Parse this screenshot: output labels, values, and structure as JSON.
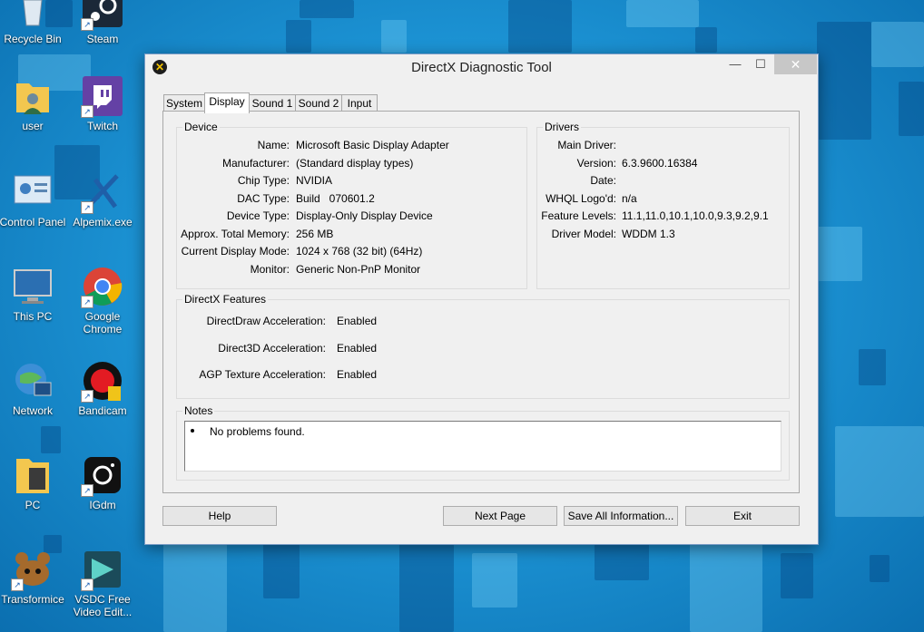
{
  "desktop": {
    "icons": [
      {
        "label": "Recycle Bin",
        "icon": "recycle-bin-icon"
      },
      {
        "label": "Steam",
        "icon": "steam-icon"
      },
      {
        "label": "user",
        "icon": "user-folder-icon"
      },
      {
        "label": "Twitch",
        "icon": "twitch-icon"
      },
      {
        "label": "Control Panel",
        "icon": "control-panel-icon"
      },
      {
        "label": "Alpemix.exe",
        "icon": "alpemix-icon"
      },
      {
        "label": "This PC",
        "icon": "this-pc-icon"
      },
      {
        "label": "Google Chrome",
        "icon": "chrome-icon"
      },
      {
        "label": "Network",
        "icon": "network-icon"
      },
      {
        "label": "Bandicam",
        "icon": "bandicam-icon"
      },
      {
        "label": "PC",
        "icon": "folder-icon"
      },
      {
        "label": "IGdm",
        "icon": "igdm-icon"
      },
      {
        "label": "Transformice",
        "icon": "transformice-icon"
      },
      {
        "label": "VSDC Free Video Edit...",
        "icon": "vsdc-icon"
      }
    ]
  },
  "window": {
    "title": "DirectX Diagnostic Tool",
    "controls": {
      "minimize": "—",
      "maximize": "☐",
      "close": "✕"
    },
    "tabs": [
      {
        "label": "System",
        "active": false
      },
      {
        "label": "Display",
        "active": true
      },
      {
        "label": "Sound 1",
        "active": false
      },
      {
        "label": "Sound 2",
        "active": false
      },
      {
        "label": "Input",
        "active": false
      }
    ],
    "device": {
      "title": "Device",
      "fields": [
        {
          "label": "Name:",
          "value": "Microsoft Basic Display Adapter"
        },
        {
          "label": "Manufacturer:",
          "value": "(Standard display types)"
        },
        {
          "label": "Chip Type:",
          "value": "NVIDIA"
        },
        {
          "label": "DAC Type:",
          "value": "Build   070601.2"
        },
        {
          "label": "Device Type:",
          "value": "Display-Only Display Device"
        },
        {
          "label": "Approx. Total Memory:",
          "value": "256 MB"
        },
        {
          "label": "Current Display Mode:",
          "value": "1024 x 768 (32 bit) (64Hz)"
        },
        {
          "label": "Monitor:",
          "value": "Generic Non-PnP Monitor"
        }
      ]
    },
    "drivers": {
      "title": "Drivers",
      "fields": [
        {
          "label": "Main Driver:",
          "value": ""
        },
        {
          "label": "Version:",
          "value": "6.3.9600.16384"
        },
        {
          "label": "Date:",
          "value": ""
        },
        {
          "label": "WHQL Logo'd:",
          "value": "n/a"
        },
        {
          "label": "Feature Levels:",
          "value": "11.1,11.0,10.1,10.0,9.3,9.2,9.1"
        },
        {
          "label": "Driver Model:",
          "value": "WDDM 1.3"
        }
      ]
    },
    "features": {
      "title": "DirectX Features",
      "fields": [
        {
          "label": "DirectDraw Acceleration:",
          "value": "Enabled"
        },
        {
          "label": "Direct3D Acceleration:",
          "value": "Enabled"
        },
        {
          "label": "AGP Texture Acceleration:",
          "value": "Enabled"
        }
      ]
    },
    "notes": {
      "title": "Notes",
      "items": [
        "No problems found."
      ]
    },
    "buttons": {
      "help": "Help",
      "next_page": "Next Page",
      "save_all": "Save All Information...",
      "exit": "Exit"
    }
  }
}
